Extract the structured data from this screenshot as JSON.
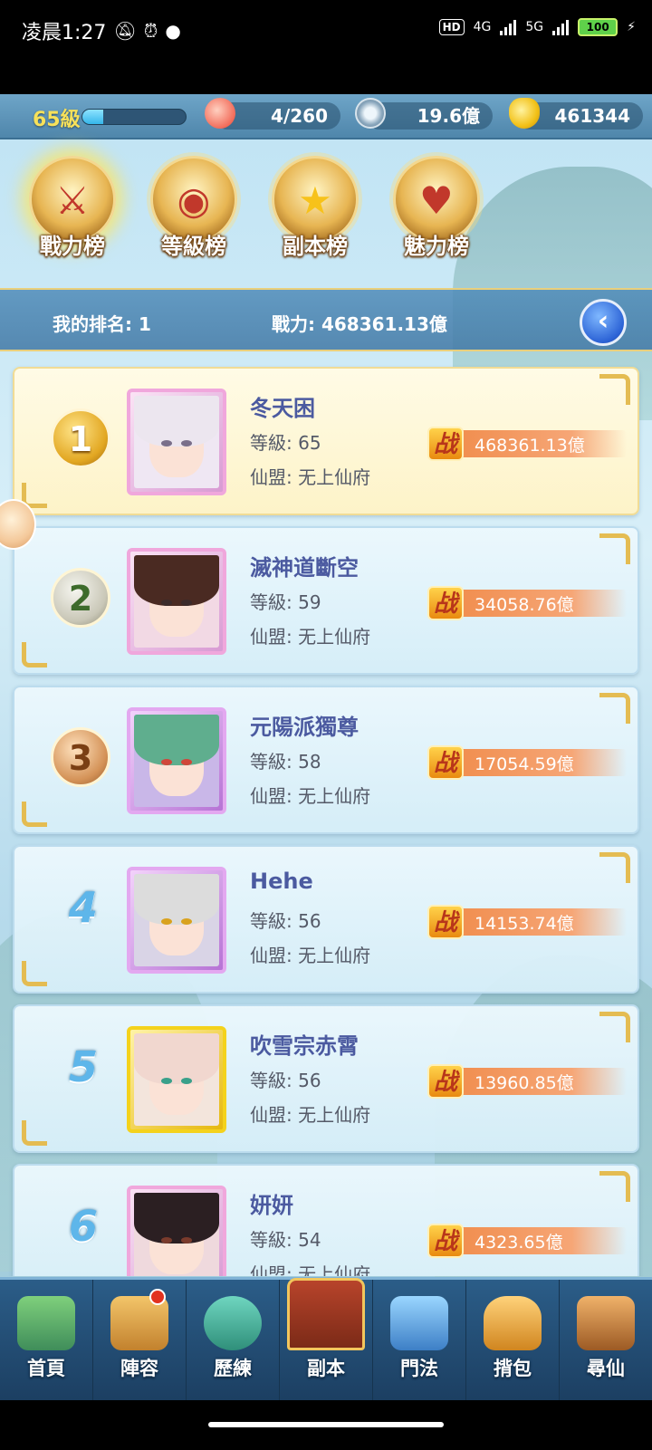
{
  "status": {
    "time": "凌晨1:27",
    "network": "4G",
    "network2": "5G",
    "battery": "100"
  },
  "resources": {
    "level": "65級",
    "xp_fraction": 0.2,
    "stamina": "4/260",
    "silver": "19.6億",
    "gold": "461344"
  },
  "tabs": [
    {
      "label": "戰力榜",
      "active": true
    },
    {
      "label": "等級榜",
      "active": false
    },
    {
      "label": "副本榜",
      "active": false
    },
    {
      "label": "魅力榜",
      "active": false
    }
  ],
  "my_rank": {
    "rank_text": "我的排名: 1",
    "power_text": "戰力: 468361.13億"
  },
  "power_icon_glyph": "战",
  "players": [
    {
      "rank": "1",
      "name": "冬天困",
      "level": "等級: 65",
      "guild": "仙盟: 无上仙府",
      "power": "468361.13億"
    },
    {
      "rank": "2",
      "name": "滅神道斷空",
      "level": "等級: 59",
      "guild": "仙盟: 无上仙府",
      "power": "34058.76億"
    },
    {
      "rank": "3",
      "name": "元陽派獨尊",
      "level": "等級: 58",
      "guild": "仙盟: 无上仙府",
      "power": "17054.59億"
    },
    {
      "rank": "4",
      "name": "Hehe",
      "level": "等級: 56",
      "guild": "仙盟: 无上仙府",
      "power": "14153.74億"
    },
    {
      "rank": "5",
      "name": "吹雪宗赤霄",
      "level": "等級: 56",
      "guild": "仙盟: 无上仙府",
      "power": "13960.85億"
    },
    {
      "rank": "6",
      "name": "妍妍",
      "level": "等級: 54",
      "guild": "仙盟: 无上仙府",
      "power": "4323.65億"
    }
  ],
  "nav": [
    {
      "label": "首頁",
      "icon": "home-icon"
    },
    {
      "label": "陣容",
      "icon": "lineup-icon"
    },
    {
      "label": "歷練",
      "icon": "training-icon"
    },
    {
      "label": "副本",
      "icon": "dungeon-icon"
    },
    {
      "label": "門法",
      "icon": "sect-icon"
    },
    {
      "label": "揹包",
      "icon": "bag-icon"
    },
    {
      "label": "尋仙",
      "icon": "seek-icon"
    }
  ]
}
